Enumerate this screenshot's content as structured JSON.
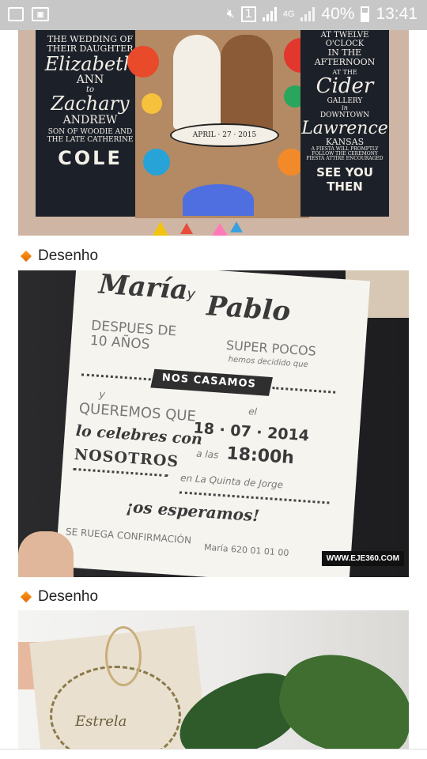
{
  "status_bar": {
    "network_label": "4G",
    "battery_percent": "40%",
    "time": "13:41"
  },
  "feed": {
    "items": [
      {
        "type": "image",
        "left_panel_lines": [
          "THE WEDDING OF",
          "THEIR DAUGHTER",
          "Elizabeth",
          "ANN",
          "to",
          "Zachary",
          "ANDREW",
          "SON OF WOODIE AND",
          "THE LATE CATHERINE",
          "COLE"
        ],
        "right_panel_lines": [
          "AT TWELVE O'CLOCK",
          "IN THE AFTERNOON",
          "AT THE",
          "Cider",
          "GALLERY",
          "in",
          "DOWNTOWN",
          "Lawrence",
          "KANSAS",
          "A FIESTA WILL PROMPTLY",
          "FOLLOW THE CEREMONY",
          "FIESTA ATTIRE ENCOURAGED",
          "SEE YOU THEN"
        ],
        "center_banner": "APRIL · 27 · 2015"
      },
      {
        "label": "Desenho",
        "type": "image",
        "title_a": "María",
        "title_b": "Pablo",
        "ampersand": "y",
        "line_left": "DESPUES DE 10 AÑOS",
        "line_right": "SUPER POCOS",
        "line_right_sub": "hemos decidido que",
        "banner": "NOS CASAMOS",
        "y_small": "y",
        "queremos": "QUEREMOS QUE",
        "celebres": "lo celebres con",
        "nosotros": "NOSOTROS",
        "el": "el",
        "date": "18 · 07 · 2014",
        "time_prefix": "a las",
        "time": "18:00h",
        "place": "en La Quinta de Jorge",
        "esperamos": "¡os esperamos!",
        "confirm": "SE RUEGA CONFIRMACIÓN",
        "confirm_name": "María 620 01 01 00",
        "watermark": "WWW.EJE360.COM"
      },
      {
        "label": "Desenho",
        "type": "image",
        "tag_text": "Estrela"
      }
    ]
  }
}
